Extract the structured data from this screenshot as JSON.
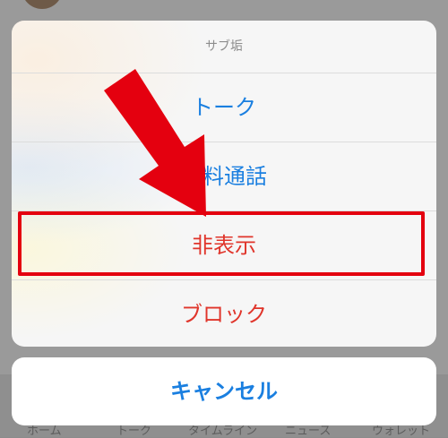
{
  "background_app": {
    "tab_labels": [
      "ホーム",
      "トーク",
      "タイムライン",
      "ニュース",
      "ウォレット"
    ]
  },
  "action_sheet": {
    "title": "サブ垢",
    "options": [
      {
        "label": "トーク",
        "color": "#1a7fe0"
      },
      {
        "label": "無料通話",
        "color": "#1a7fe0"
      },
      {
        "label": "非表示",
        "color": "#e0352b"
      },
      {
        "label": "ブロック",
        "color": "#e0352b"
      }
    ],
    "cancel_label": "キャンセル"
  },
  "annotation": {
    "highlight_color": "#e4000f",
    "arrow_color": "#e4000f",
    "highlighted_option": "非表示"
  }
}
